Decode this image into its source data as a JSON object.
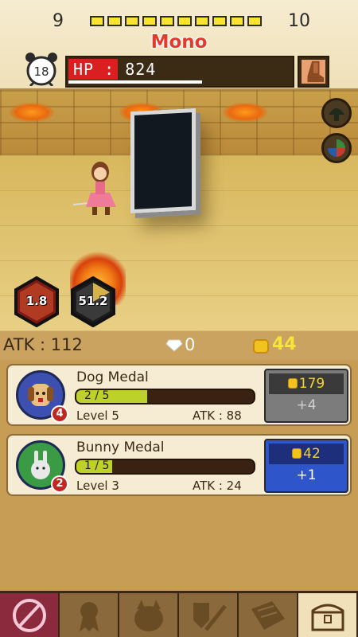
{
  "hud": {
    "stage_current": "9",
    "stage_next": "10",
    "stage_segments": 10,
    "enemy_name": "Mono",
    "timer_value": "18",
    "hp_label": "HP : 824",
    "hp_fraction": 0.22,
    "hp_sub_fraction": 0.6
  },
  "skills": [
    {
      "value": "1.8"
    },
    {
      "value": "51.2"
    }
  ],
  "stats": {
    "atk_label": "ATK : 112",
    "gems": "0",
    "coins": "44"
  },
  "medals": [
    {
      "name": "Dog Medal",
      "badge": "4",
      "progress_text": "2 / 5",
      "progress_fraction": 0.4,
      "level": "Level 5",
      "atk": "ATK : 88",
      "cost": "179",
      "gain": "+4",
      "affordable": false
    },
    {
      "name": "Bunny Medal",
      "badge": "2",
      "progress_text": "1 / 5",
      "progress_fraction": 0.2,
      "level": "Level 3",
      "atk": "ATK : 24",
      "cost": "42",
      "gain": "+1",
      "affordable": true
    }
  ],
  "nav": {
    "tabs": [
      "sword-skill-icon",
      "medal-ribbon-icon",
      "monster-icon",
      "weapons-icon",
      "map-scroll-icon",
      "treasure-chest-icon"
    ]
  },
  "colors": {
    "hp": "#d91f1f",
    "coin": "#f5e53a",
    "enemy_name": "#e23b2d",
    "buy_active": "#2e55c9",
    "progress": "#bcd22a"
  }
}
